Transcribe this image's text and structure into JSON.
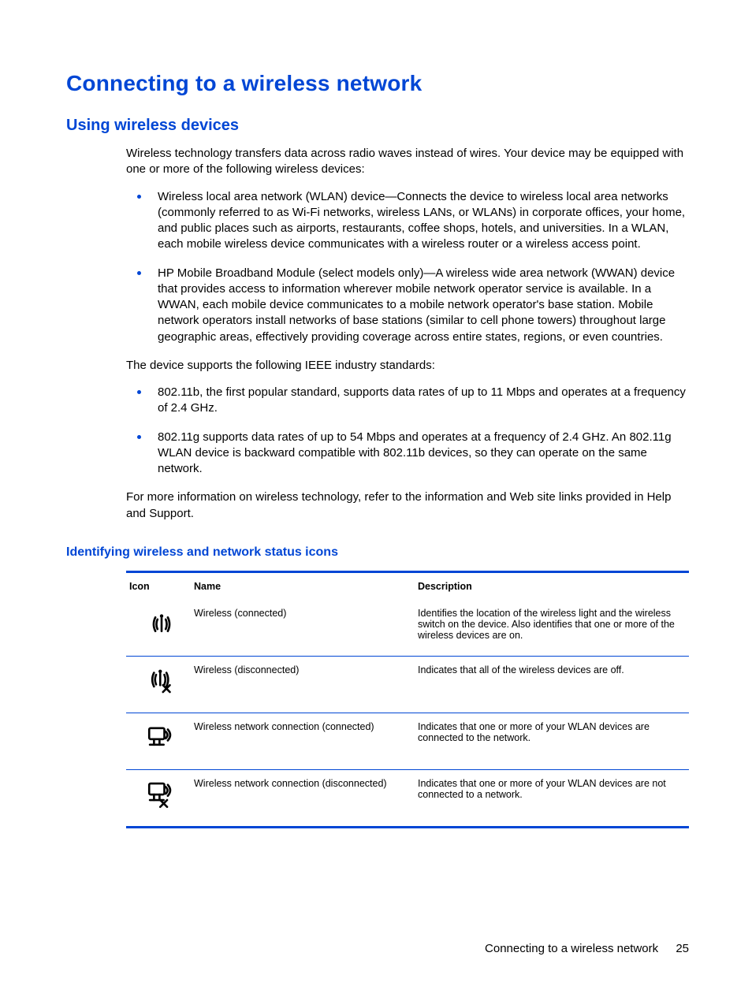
{
  "heading_main": "Connecting to a wireless network",
  "heading_section": "Using wireless devices",
  "intro_para": "Wireless technology transfers data across radio waves instead of wires. Your device may be equipped with one or more of the following wireless devices:",
  "devices": [
    "Wireless local area network (WLAN) device—Connects the device to wireless local area networks (commonly referred to as Wi-Fi networks, wireless LANs, or WLANs) in corporate offices, your home, and public places such as airports, restaurants, coffee shops, hotels, and universities. In a WLAN, each mobile wireless device communicates with a wireless router or a wireless access point.",
    "HP Mobile Broadband Module (select models only)—A wireless wide area network (WWAN) device that provides access to information wherever mobile network operator service is available. In a WWAN, each mobile device communicates to a mobile network operator's base station. Mobile network operators install networks of base stations (similar to cell phone towers) throughout large geographic areas, effectively providing coverage across entire states, regions, or even countries."
  ],
  "standards_intro": "The device  supports the following IEEE industry standards:",
  "standards": [
    "802.11b, the first popular standard, supports data rates of up to 11 Mbps and operates at a frequency of 2.4 GHz.",
    "802.11g supports data rates of up to 54 Mbps and operates at a frequency of 2.4 GHz. An 802.11g WLAN device is backward compatible with 802.11b devices, so they can operate on the same network."
  ],
  "more_info": "For more information on wireless technology, refer to the information and Web site links provided in Help and Support.",
  "heading_subsection": "Identifying wireless and network status icons",
  "table": {
    "head": {
      "icon": "Icon",
      "name": "Name",
      "desc": "Description"
    },
    "rows": [
      {
        "icon": "wireless-connected-icon",
        "name": "Wireless (connected)",
        "desc": "Identifies the location of the wireless light and the wireless switch on the device. Also identifies that one or more of the wireless devices are on."
      },
      {
        "icon": "wireless-disconnected-icon",
        "name": "Wireless (disconnected)",
        "desc": "Indicates that all of the wireless devices are off."
      },
      {
        "icon": "wlan-connected-icon",
        "name": "Wireless network connection (connected)",
        "desc": "Indicates that one or more of your WLAN devices are connected to the network."
      },
      {
        "icon": "wlan-disconnected-icon",
        "name": "Wireless network connection (disconnected)",
        "desc": "Indicates that one or more of your WLAN devices are not connected to a network."
      }
    ]
  },
  "footer": {
    "title": "Connecting to a wireless network",
    "page": "25"
  }
}
